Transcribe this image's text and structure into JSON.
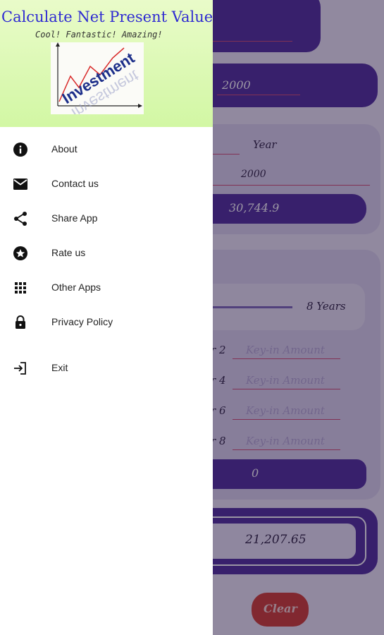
{
  "drawer": {
    "title": "Calculate Net Present Value",
    "tagline": "Cool! Fantastic! Amazing!",
    "logo_text": "Investment",
    "menu": [
      {
        "label": "About",
        "icon": "info-icon"
      },
      {
        "label": "Contact us",
        "icon": "mail-icon"
      },
      {
        "label": "Share App",
        "icon": "share-icon"
      },
      {
        "label": "Rate us",
        "icon": "star-circle-icon"
      },
      {
        "label": "Other Apps",
        "icon": "apps-grid-icon"
      },
      {
        "label": "Privacy Policy",
        "icon": "lock-icon"
      },
      {
        "label": "Exit",
        "icon": "exit-icon"
      }
    ]
  },
  "background": {
    "top_value": "2000",
    "year_label": "Year",
    "year_value": "2000",
    "result_value": "30,744.9",
    "years_label": "8 Years",
    "rows": [
      {
        "label": "r 2",
        "placeholder": "Key-in Amount"
      },
      {
        "label": "r 4",
        "placeholder": "Key-in Amount"
      },
      {
        "label": "r 6",
        "placeholder": "Key-in Amount"
      },
      {
        "label": "r 8",
        "placeholder": "Key-in Amount"
      }
    ],
    "sum_value": "0",
    "npv_value": "21,207.65",
    "clear_label": "Clear"
  },
  "colors": {
    "accent": "#4d2a9c",
    "header_green": "#d2f7a4",
    "title_blue": "#2f2bd2",
    "clear_red": "#d13a2f"
  }
}
